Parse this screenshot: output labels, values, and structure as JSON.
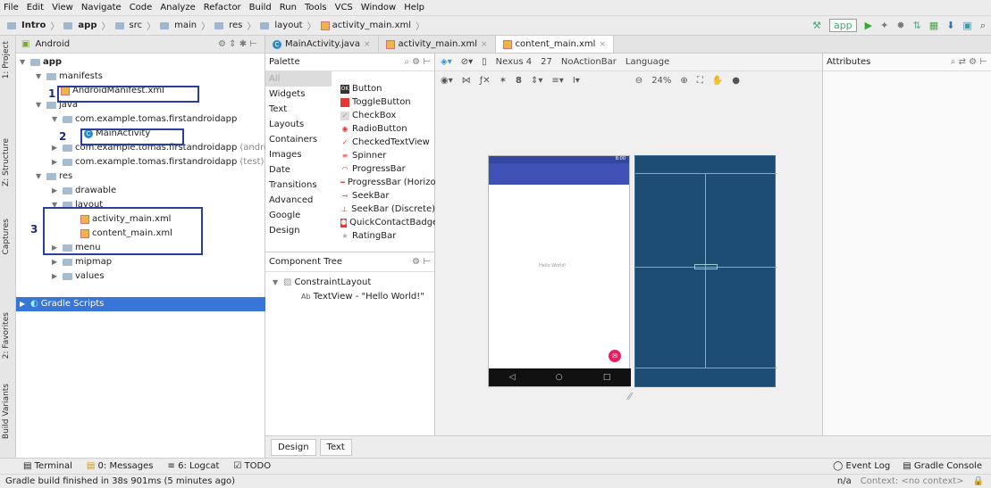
{
  "menu": [
    "File",
    "Edit",
    "View",
    "Navigate",
    "Code",
    "Analyze",
    "Refactor",
    "Build",
    "Run",
    "Tools",
    "VCS",
    "Window",
    "Help"
  ],
  "breadcrumb": [
    "Intro",
    "app",
    "src",
    "main",
    "res",
    "layout",
    "activity_main.xml"
  ],
  "run_config": "app",
  "side_tabs": {
    "project": "1: Project",
    "structure": "Z: Structure",
    "captures": "Captures",
    "favorites": "2: Favorites",
    "build_variants": "Build Variants"
  },
  "project_panel": {
    "view": "Android"
  },
  "tree": {
    "app": "app",
    "manifests": "manifests",
    "manifest_file": "AndroidManifest.xml",
    "java": "java",
    "pkg1": "com.example.tomas.firstandroidapp",
    "main_activity": "MainActivity",
    "pkg2": "com.example.tomas.firstandroidapp",
    "pkg2_suffix": "(androidT",
    "pkg3": "com.example.tomas.firstandroidapp",
    "pkg3_suffix": "(test)",
    "res": "res",
    "drawable": "drawable",
    "layout": "layout",
    "activity_main": "activity_main.xml",
    "content_main": "content_main.xml",
    "menu": "menu",
    "mipmap": "mipmap",
    "values": "values",
    "gradle": "Gradle Scripts"
  },
  "annotations": {
    "one": "1",
    "two": "2",
    "three": "3"
  },
  "editor_tabs": [
    {
      "label": "MainActivity.java"
    },
    {
      "label": "activity_main.xml"
    },
    {
      "label": "content_main.xml"
    }
  ],
  "palette": {
    "title": "Palette",
    "categories": [
      "All",
      "Widgets",
      "Text",
      "Layouts",
      "Containers",
      "Images",
      "Date",
      "Transitions",
      "Advanced",
      "Google",
      "Design"
    ],
    "items": [
      {
        "label": "Button",
        "icon": "ok"
      },
      {
        "label": "ToggleButton",
        "icon": "toggle"
      },
      {
        "label": "CheckBox",
        "icon": "check"
      },
      {
        "label": "RadioButton",
        "icon": "radio"
      },
      {
        "label": "CheckedTextView",
        "icon": "checked"
      },
      {
        "label": "Spinner",
        "icon": "spinner"
      },
      {
        "label": "ProgressBar",
        "icon": "progress"
      },
      {
        "label": "ProgressBar (Horizontal)",
        "icon": "hprogress"
      },
      {
        "label": "SeekBar",
        "icon": "seek"
      },
      {
        "label": "SeekBar (Discrete)",
        "icon": "seekd"
      },
      {
        "label": "QuickContactBadge",
        "icon": "contact"
      },
      {
        "label": "RatingBar",
        "icon": "star"
      }
    ]
  },
  "component_tree": {
    "title": "Component Tree",
    "root": "ConstraintLayout",
    "child": "TextView - \"Hello World!\"",
    "child_prefix": "Ab"
  },
  "design_toolbar": {
    "device": "Nexus 4",
    "api": "27",
    "theme": "NoActionBar",
    "language": "Language",
    "zoom": "24%",
    "margin": "8"
  },
  "phone": {
    "status_time": "8:00",
    "hello": "Hello World!"
  },
  "attributes": {
    "title": "Attributes"
  },
  "design_tabs": [
    "Design",
    "Text"
  ],
  "bottom_tools": {
    "terminal": "Terminal",
    "messages": "0: Messages",
    "logcat": "6: Logcat",
    "todo": "TODO",
    "event_log": "Event Log",
    "gradle_console": "Gradle Console"
  },
  "status": {
    "message": "Gradle build finished in 38s 901ms (5 minutes ago)",
    "na": "n/a",
    "context": "Context: <no context>"
  },
  "colors": {
    "annotation_box": "#2a3ea0",
    "selection": "#3875d7",
    "blueprint": "#1e4d73",
    "app_bar": "#3f51b5",
    "fab": "#e91e63"
  }
}
